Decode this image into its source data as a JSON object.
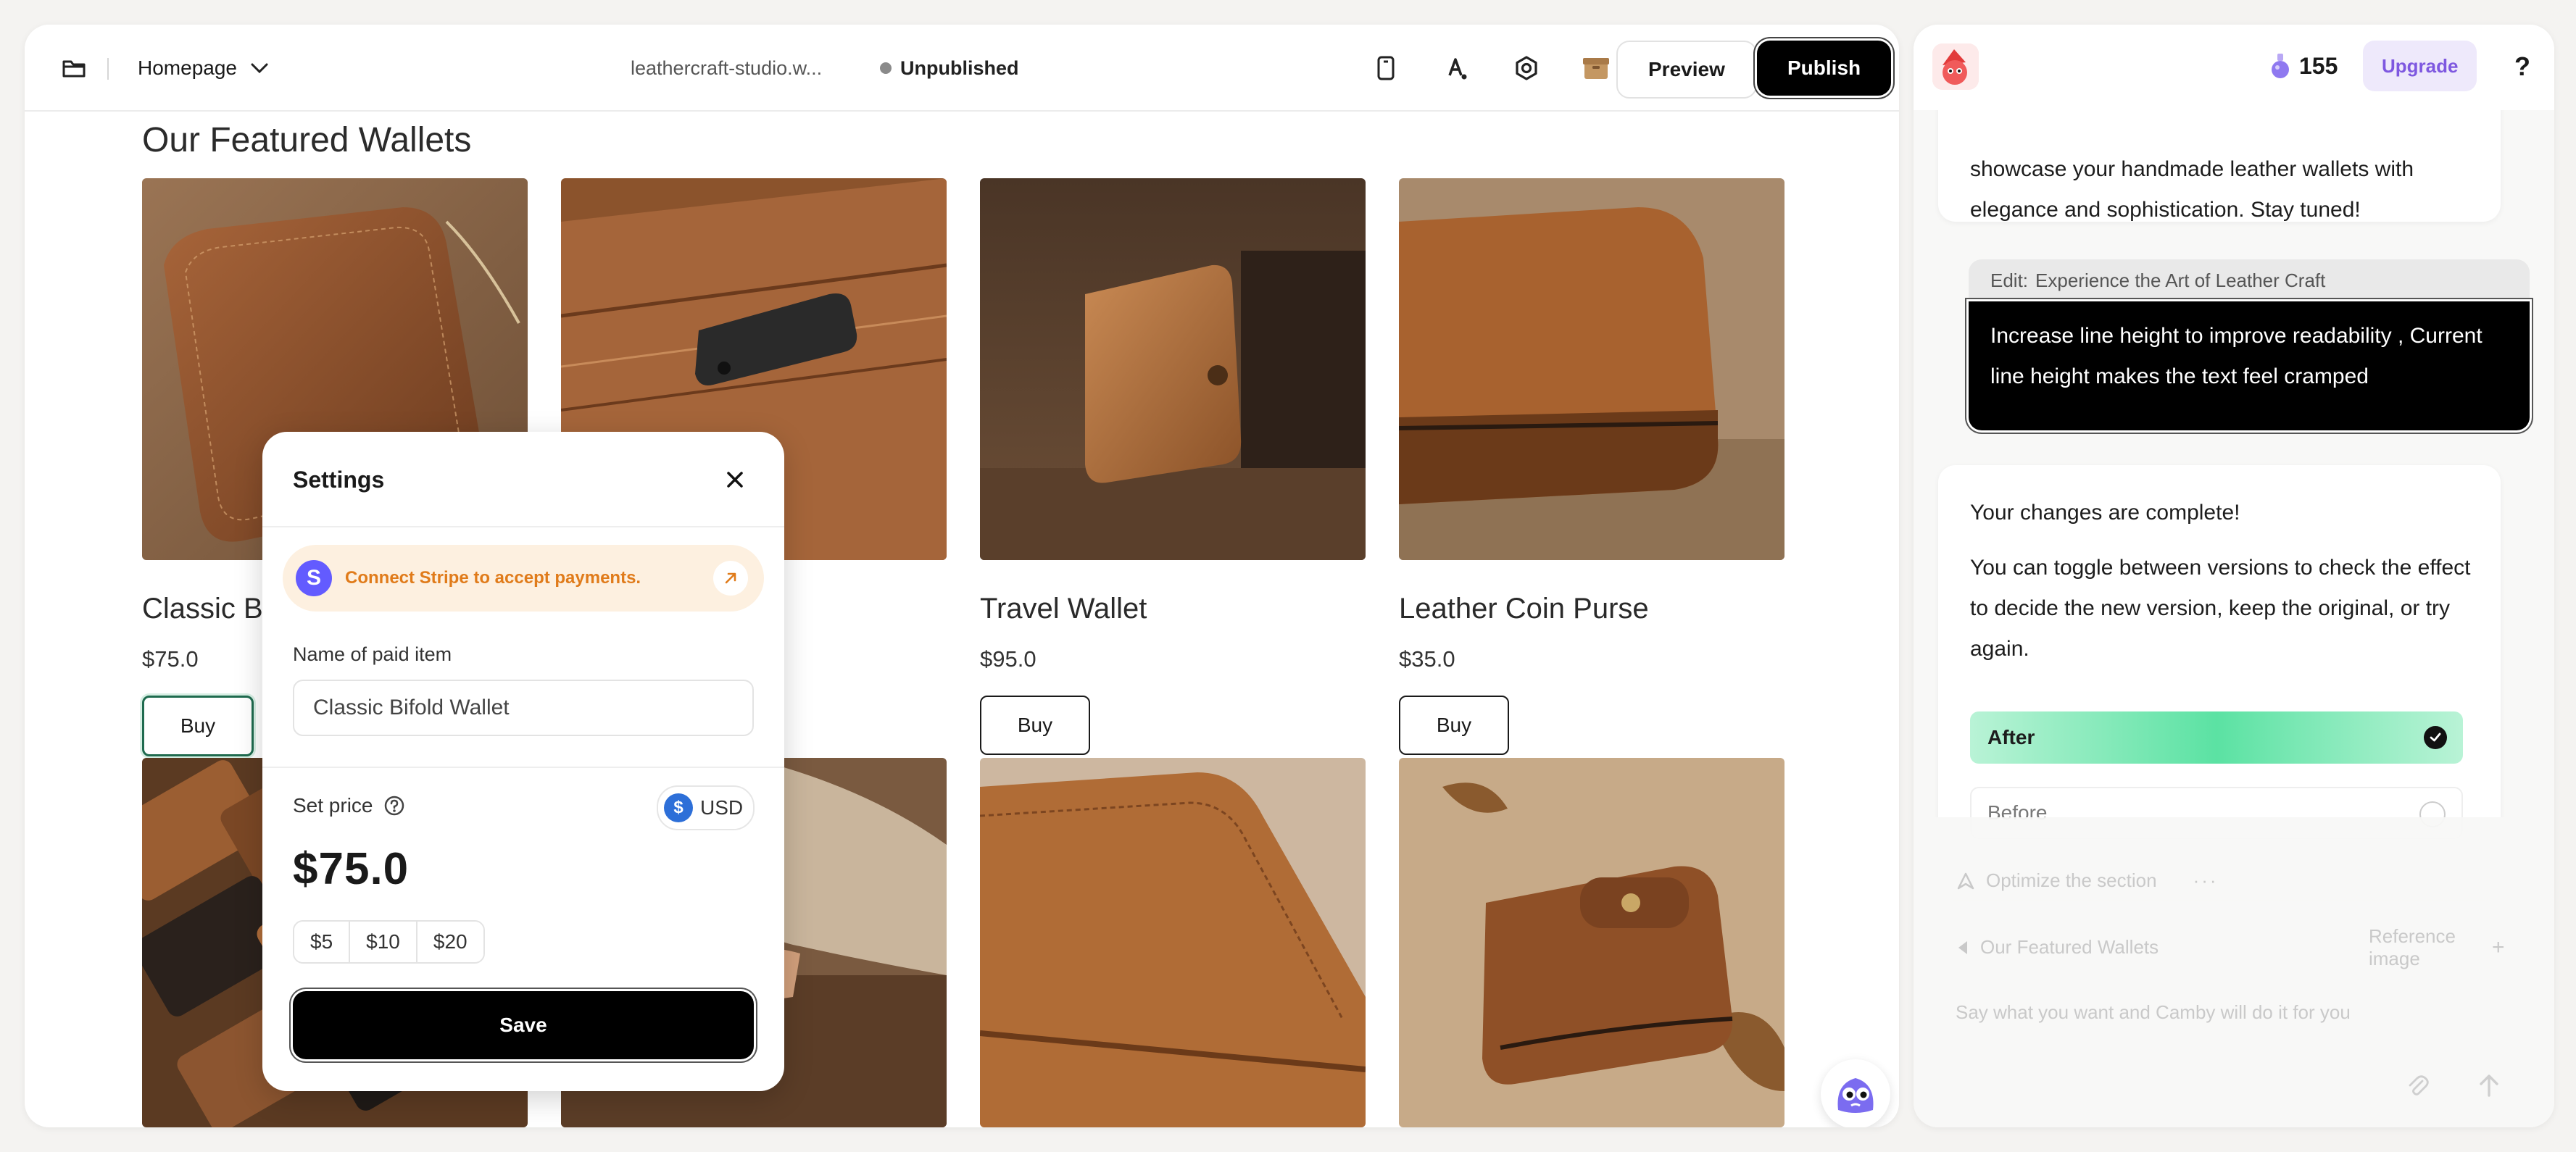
{
  "topbar": {
    "page_select": "Homepage",
    "site_url": "leathercraft-studio.w...",
    "status": "Unpublished",
    "preview_label": "Preview",
    "publish_label": "Publish"
  },
  "section": {
    "title": "Our Featured Wallets",
    "products": [
      {
        "name": "Classic Bi",
        "price": "$75.0",
        "buy": "Buy"
      },
      {
        "name": "",
        "price": "",
        "buy": ""
      },
      {
        "name": "Travel Wallet",
        "price": "$95.0",
        "buy": "Buy"
      },
      {
        "name": "Leather Coin Purse",
        "price": "$35.0",
        "buy": "Buy"
      }
    ]
  },
  "settings_modal": {
    "title": "Settings",
    "stripe_text": "Connect Stripe to accept payments.",
    "stripe_logo": "S",
    "item_label": "Name of paid item",
    "item_value": "Classic Bifold Wallet",
    "price_label": "Set price",
    "currency_symbol": "$",
    "currency": "USD",
    "price": "$75.0",
    "presets": [
      "$5",
      "$10",
      "$20"
    ],
    "save_label": "Save"
  },
  "chat": {
    "credits": "155",
    "upgrade_label": "Upgrade",
    "help": "?",
    "prev_message": "showcase your handmade leather wallets with elegance and sophistication. Stay tuned!",
    "edit_prefix": "Edit:",
    "edit_target": "Experience the Art of Leather Craft",
    "user_message": "Increase line height to improve readability , Current line height makes the text feel cramped",
    "reply_title": "Your changes are complete!",
    "reply_body": "You can toggle between versions to check the effect to decide the new version, keep the original, or try again.",
    "version_after": "After",
    "version_before": "Before",
    "composer": {
      "optimize_label": "Optimize the section",
      "more": "···",
      "context_label": "Our Featured Wallets",
      "reference_label": "Reference image",
      "plus": "+",
      "placeholder": "Say what you want and Camby will do it for you"
    }
  },
  "colors": {
    "accent_green": "#5be2a3",
    "stripe_orange": "#e07b1a",
    "upgrade_purple": "#7e58e0",
    "leather": "#8a5a33"
  }
}
